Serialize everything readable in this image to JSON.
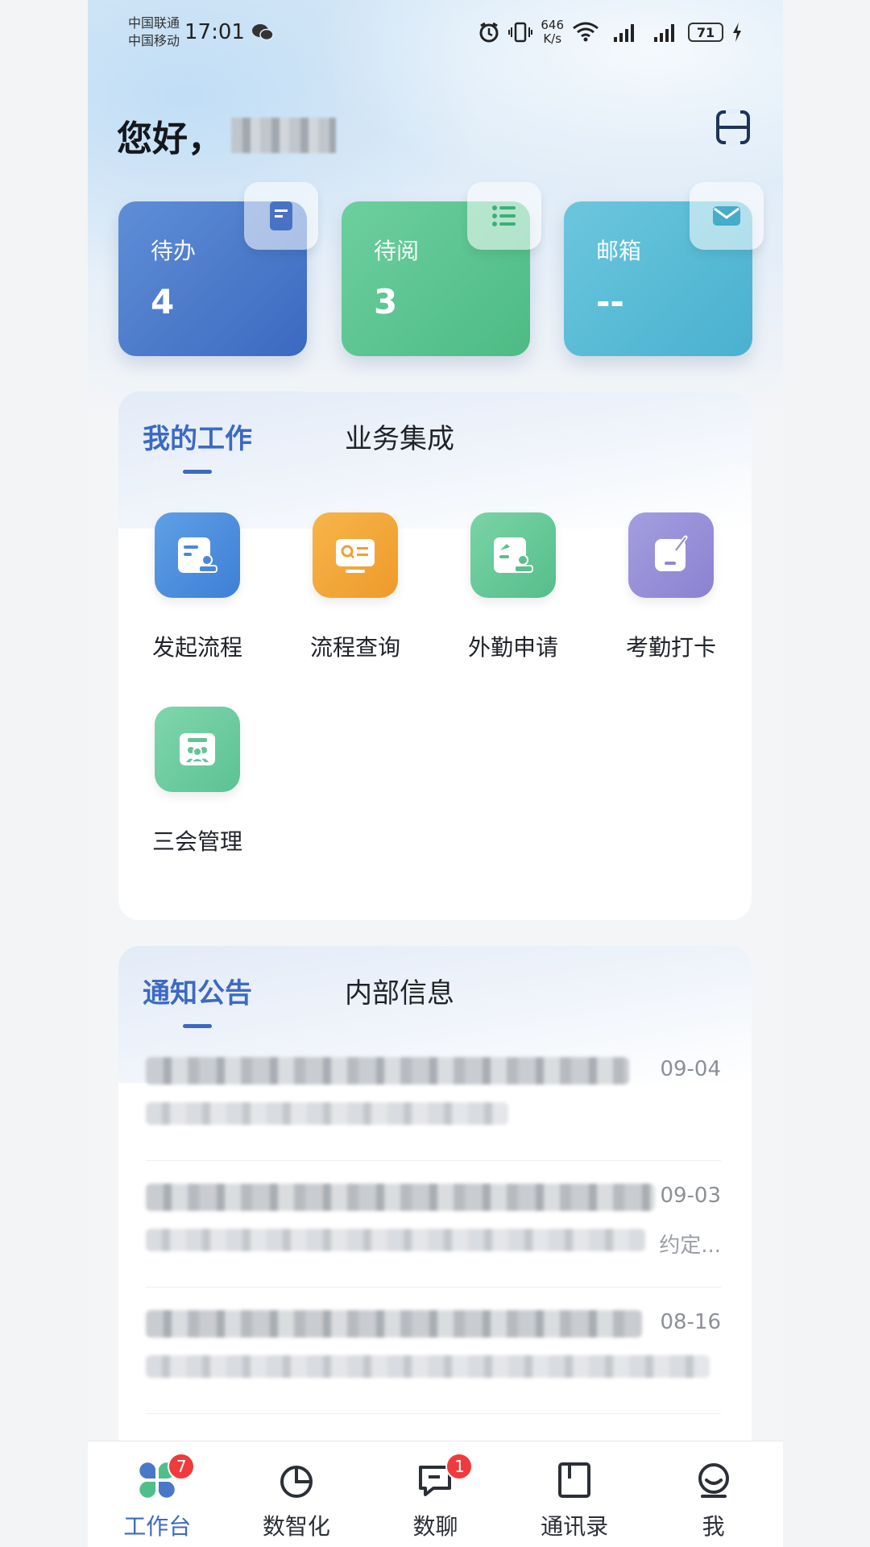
{
  "status_bar": {
    "carrier_1": "中国联通",
    "carrier_2": "中国移动",
    "time": "17:01",
    "net_speed_value": "646",
    "net_speed_unit": "K/s",
    "battery": "71"
  },
  "header": {
    "greeting": "您好，"
  },
  "stats": [
    {
      "label": "待办",
      "value": "4"
    },
    {
      "label": "待阅",
      "value": "3"
    },
    {
      "label": "邮箱",
      "value": "--"
    }
  ],
  "work_panel": {
    "tabs": [
      {
        "label": "我的工作",
        "active": true
      },
      {
        "label": "业务集成",
        "active": false
      }
    ],
    "apps": [
      {
        "label": "发起流程",
        "icon": "start-process-icon"
      },
      {
        "label": "流程查询",
        "icon": "process-query-icon"
      },
      {
        "label": "外勤申请",
        "icon": "field-work-icon"
      },
      {
        "label": "考勤打卡",
        "icon": "attendance-icon"
      },
      {
        "label": "三会管理",
        "icon": "meeting-management-icon"
      }
    ]
  },
  "notice_panel": {
    "tabs": [
      {
        "label": "通知公告",
        "active": true
      },
      {
        "label": "内部信息",
        "active": false
      }
    ],
    "items": [
      {
        "date": "09-04",
        "tail": ""
      },
      {
        "date": "09-03",
        "tail": "约定..."
      },
      {
        "date": "08-16",
        "tail": ""
      }
    ]
  },
  "bottom_nav": {
    "items": [
      {
        "label": "工作台",
        "badge": "7",
        "active": true
      },
      {
        "label": "数智化",
        "badge": "",
        "active": false
      },
      {
        "label": "数聊",
        "badge": "1",
        "active": false
      },
      {
        "label": "通讯录",
        "badge": "",
        "active": false
      },
      {
        "label": "我",
        "badge": "",
        "active": false
      }
    ]
  },
  "colors": {
    "accent": "#3c6ac2",
    "badge": "#ef3b3b",
    "todo_card": "#4a78c9",
    "toread_card": "#55c08c",
    "mail_card": "#55b8d4"
  }
}
